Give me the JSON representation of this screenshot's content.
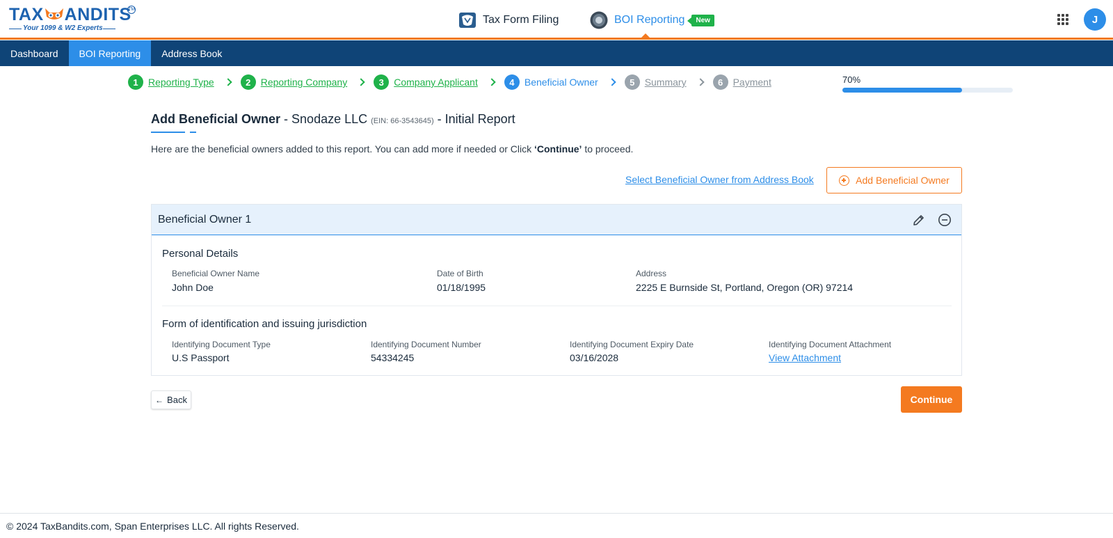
{
  "brand": {
    "logo_text_left": "TAX",
    "logo_text_right": "ANDITS",
    "tagline": "Your 1099 & W2 Experts",
    "tm": "TM"
  },
  "topnav": {
    "tax_form_filing": "Tax Form Filing",
    "boi_reporting": "BOI Reporting",
    "new_badge": "New",
    "avatar_initial": "J",
    "accent_color": "#f47a20"
  },
  "navbar": {
    "items": [
      {
        "label": "Dashboard"
      },
      {
        "label": "BOI Reporting"
      },
      {
        "label": "Address Book"
      }
    ]
  },
  "stepper": {
    "steps": [
      {
        "num": "1",
        "label": "Reporting Type",
        "state": "done"
      },
      {
        "num": "2",
        "label": "Reporting Company",
        "state": "done"
      },
      {
        "num": "3",
        "label": "Company Applicant",
        "state": "done"
      },
      {
        "num": "4",
        "label": "Beneficial Owner",
        "state": "current"
      },
      {
        "num": "5",
        "label": "Summary",
        "state": "todo"
      },
      {
        "num": "6",
        "label": "Payment",
        "state": "todo"
      }
    ],
    "progress_label": "70%",
    "progress_fraction": 0.7
  },
  "page": {
    "title_bold": "Add Beneficial Owner",
    "title_company": " - Snodaze LLC ",
    "ein": "(EIN: 66-3543645)",
    "title_suffix": " - Initial Report",
    "intro_prefix": "Here are the beneficial owners added to this report. You can add more if needed or Click ",
    "intro_bold": "‘Continue’",
    "intro_suffix": " to proceed.",
    "select_link": "Select Beneficial Owner from Address Book",
    "add_button": "Add Beneficial Owner"
  },
  "owner_card": {
    "title": "Beneficial Owner 1",
    "personal_title": "Personal Details",
    "name_label": "Beneficial Owner Name",
    "name_value": "John Doe",
    "dob_label": "Date of Birth",
    "dob_value": "01/18/1995",
    "address_label": "Address",
    "address_value": "2225 E Burnside St, Portland, Oregon (OR) 97214",
    "id_title": "Form of identification and issuing jurisdiction",
    "doc_type_label": "Identifying Document Type",
    "doc_type_value": "U.S Passport",
    "doc_number_label": "Identifying Document Number",
    "doc_number_value": "54334245",
    "doc_expiry_label": "Identifying Document Expiry Date",
    "doc_expiry_value": "03/16/2028",
    "doc_attachment_label": "Identifying Document Attachment",
    "doc_attachment_link": "View Attachment"
  },
  "actions": {
    "back": "Back",
    "continue": "Continue"
  },
  "footer": {
    "text": "© 2024 TaxBandits.com, Span Enterprises LLC. All rights Reserved."
  }
}
